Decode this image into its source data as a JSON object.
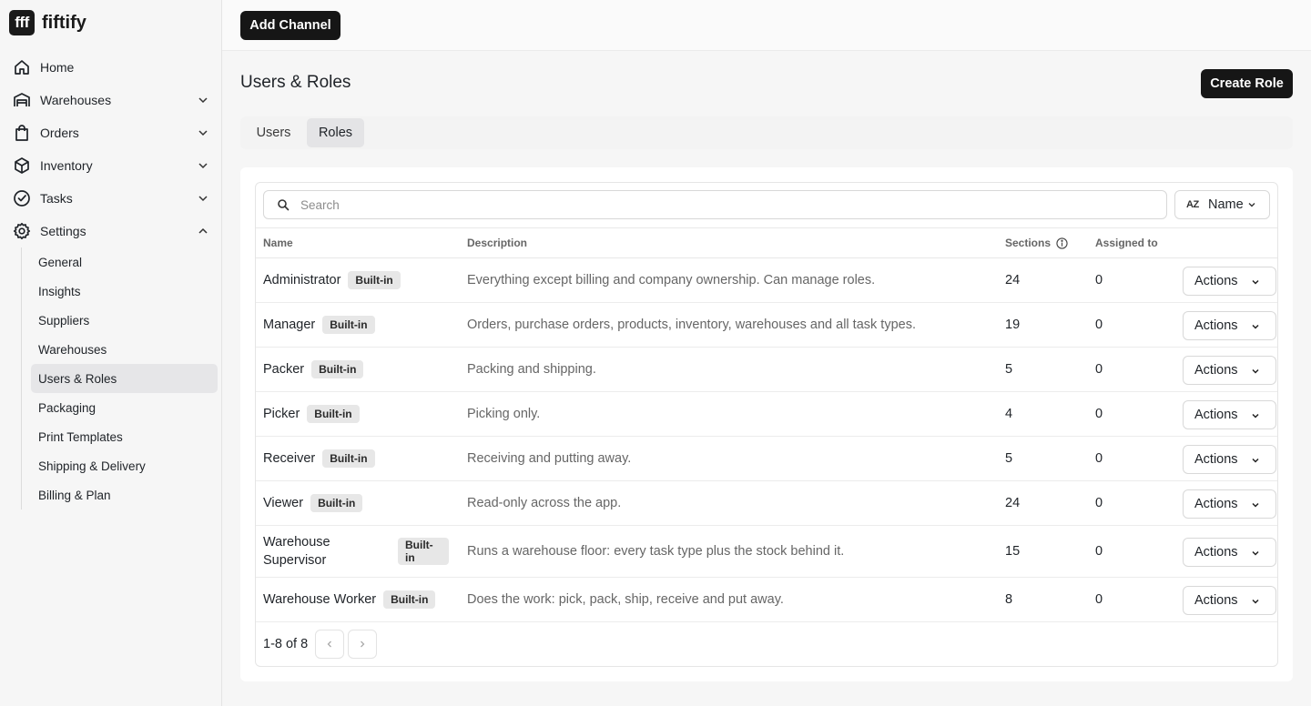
{
  "brand": {
    "logo": "fff",
    "name": "fiftify"
  },
  "nav": {
    "items": [
      {
        "label": "Home",
        "icon": "home-icon"
      },
      {
        "label": "Warehouses",
        "icon": "warehouse-icon"
      },
      {
        "label": "Orders",
        "icon": "shopping-bag-icon"
      },
      {
        "label": "Inventory",
        "icon": "box-icon"
      },
      {
        "label": "Tasks",
        "icon": "check-circle-icon"
      },
      {
        "label": "Settings",
        "icon": "gear-icon"
      }
    ],
    "settings_sub": [
      "General",
      "Insights",
      "Suppliers",
      "Warehouses",
      "Users & Roles",
      "Packaging",
      "Print Templates",
      "Shipping & Delivery",
      "Billing & Plan"
    ],
    "active_sub": "Users & Roles"
  },
  "topbar": {
    "add_channel": "Add Channel"
  },
  "page": {
    "title": "Users & Roles",
    "create_role": "Create Role"
  },
  "tabs": {
    "users": "Users",
    "roles": "Roles",
    "active": "Roles"
  },
  "toolbar": {
    "search_placeholder": "Search",
    "sort_label": "Name",
    "sort_icon": "AZ"
  },
  "table": {
    "headers": {
      "name": "Name",
      "description": "Description",
      "sections": "Sections",
      "assigned": "Assigned to"
    },
    "badge": "Built-in",
    "action_label": "Actions",
    "rows": [
      {
        "name": "Administrator",
        "description": "Everything except billing and company ownership. Can manage roles.",
        "sections": "24",
        "assigned": "0"
      },
      {
        "name": "Manager",
        "description": "Orders, purchase orders, products, inventory, warehouses and all task types.",
        "sections": "19",
        "assigned": "0"
      },
      {
        "name": "Packer",
        "description": "Packing and shipping.",
        "sections": "5",
        "assigned": "0"
      },
      {
        "name": "Picker",
        "description": "Picking only.",
        "sections": "4",
        "assigned": "0"
      },
      {
        "name": "Receiver",
        "description": "Receiving and putting away.",
        "sections": "5",
        "assigned": "0"
      },
      {
        "name": "Viewer",
        "description": "Read-only across the app.",
        "sections": "24",
        "assigned": "0"
      },
      {
        "name": "Warehouse Supervisor",
        "description": "Runs a warehouse floor: every task type plus the stock behind it.",
        "sections": "15",
        "assigned": "0"
      },
      {
        "name": "Warehouse Worker",
        "description": "Does the work: pick, pack, ship, receive and put away.",
        "sections": "8",
        "assigned": "0"
      }
    ]
  },
  "pagination": {
    "text": "1-8 of 8"
  }
}
